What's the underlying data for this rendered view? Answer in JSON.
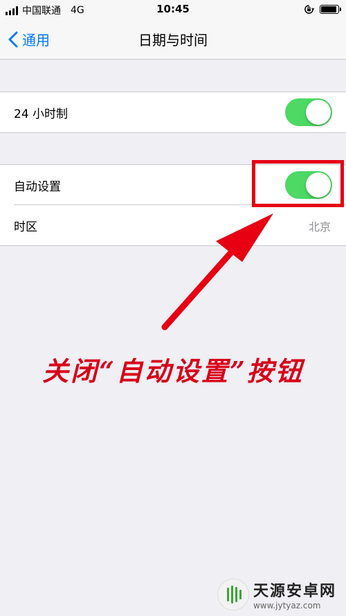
{
  "status_bar": {
    "carrier": "中国联通",
    "network": "4G",
    "time": "10:45",
    "battery_level": 0.9,
    "icons": [
      "signal-icon",
      "orientation-lock-icon",
      "battery-icon"
    ]
  },
  "nav": {
    "back_label": "通用",
    "title": "日期与时间"
  },
  "settings": {
    "hour24": {
      "label": "24 小时制",
      "on": true
    },
    "auto_set": {
      "label": "自动设置",
      "on": true
    },
    "timezone": {
      "label": "时区",
      "value": "北京"
    }
  },
  "annotation": {
    "text": "关闭“自动设置”按钮",
    "color": "#e60012"
  },
  "watermark": {
    "name": "天源安卓网",
    "url": "www.jytyaz.com"
  },
  "colors": {
    "accent": "#007aff",
    "toggle_on": "#4cd964",
    "background": "#efeff4"
  }
}
